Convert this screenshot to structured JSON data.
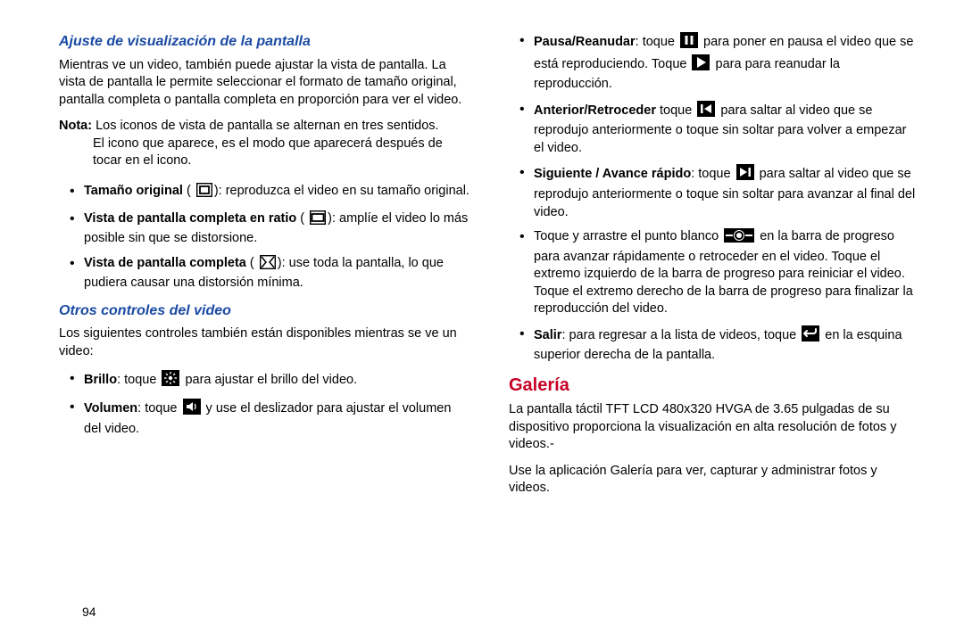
{
  "page_number": "94",
  "left": {
    "h1": "Ajuste de visualización de la pantalla",
    "p1": "Mientras ve un video, también puede ajustar la vista de pantalla. La vista de pantalla le permite seleccionar el formato de tamaño original, pantalla completa o pantalla completa en proporción para ver el video.",
    "note_label": "Nota:",
    "note_line1": " Los iconos de vista de pantalla se alternan en tres sentidos.",
    "note_line2": "El icono que aparece, es el modo que aparecerá después de tocar en el icono.",
    "b1_title": "Tamaño original",
    "b1_rest": "): reproduzca el video en su tamaño original.",
    "b2_title": "Vista de pantalla completa en ratio",
    "b2_rest": "): amplíe el video lo más posible sin que se distorsione.",
    "b3_title": "Vista de pantalla completa",
    "b3_rest": "): use toda la pantalla, lo que pudiera causar una distorsión mínima.",
    "h2": "Otros controles del video",
    "p2": "Los siguientes controles también están disponibles mientras se ve un video:",
    "c1_title": "Brillo",
    "c1_rest": " para ajustar el brillo del video.",
    "c2_title": "Volumen",
    "c2_rest": " y use el deslizador para ajustar el volumen del video."
  },
  "right": {
    "d1_title": "Pausa/Reanudar",
    "d1_mid": " para poner en pausa el video que se está reproduciendo. Toque ",
    "d1_end": " para reanudar la reproducción.",
    "d2_title": "Anterior/Retroceder",
    "d2_rest": " para saltar al video que se reprodujo anteriormente o toque sin soltar para volver a empezar el video.",
    "d3_title": "Siguiente / Avance rápido",
    "d3_rest": " para saltar al video que se reprodujo anteriormente o toque sin soltar para avanzar al final del video.",
    "d4_pre": "Toque y arrastre el punto blanco ",
    "d4_rest": " en la barra de progreso para avanzar rápidamente o retroceder en el video. Toque el extremo izquierdo de la barra de progreso para reiniciar el video. Toque el extremo derecho de la barra de progreso para finalizar la reproducción del video.",
    "d5_title": "Salir",
    "d5_mid": ": para regresar a la lista de videos, toque ",
    "d5_end": " en la esquina superior derecha de la pantalla.",
    "section": "Galería",
    "gp1": "La pantalla táctil TFT LCD 480x320 HVGA de 3.65 pulgadas de su dispositivo proporciona la visualización en alta resolución de fotos y videos.-",
    "gp2": "Use la aplicación Galería para ver, capturar y administrar fotos y videos.",
    "toque": ": toque ",
    "toque2": " toque "
  }
}
